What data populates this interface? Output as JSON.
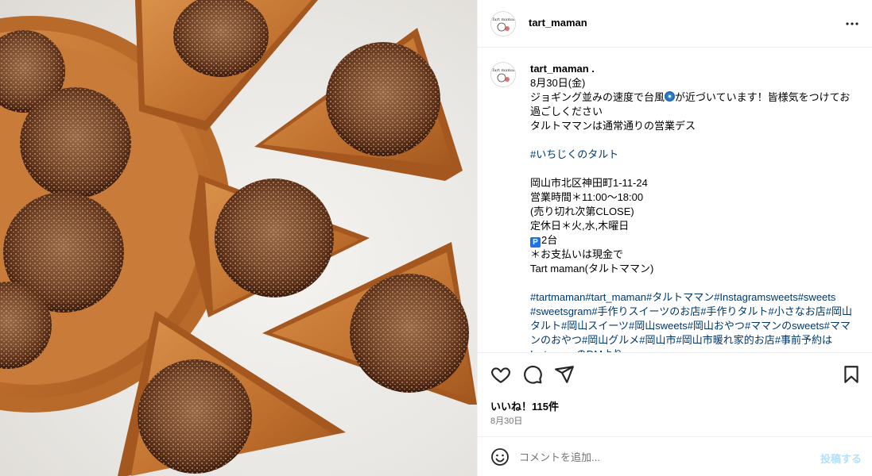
{
  "post": {
    "username": "tart_maman",
    "avatar_text": "Tart maman",
    "image_alt": "fig tart slices photo"
  },
  "caption": {
    "username": "tart_maman .",
    "lines": {
      "date": "8月30日(金)",
      "l1": "ジョギング並みの速度で台風",
      "l1b": "が近づいています！皆様気をつけてお過ごしください",
      "l2": "タルトママンは通常通りの営業デス",
      "tag1": "#いちじくのタルト",
      "addr": "岡山市北区神田町1-11-24",
      "hours": "営業時間＊11:00〜18:00",
      "soldout": "(売り切れ次第CLOSE)",
      "closed": "定休日＊火,水,木曜日",
      "parking_icon": "P",
      "parking": "2台",
      "payment": "＊お支払いは現金で",
      "shop": "Tart maman(タルトママン)"
    },
    "hashtags": [
      "#tartmaman",
      "#tart_maman",
      "#タルトママン",
      "#Instagramsweets",
      "#sweets",
      " #sweetsgram",
      "#手作りスイーツのお店",
      "#手作りタルト",
      "#小さなお店",
      "#岡山タルト",
      "#岡山スイーツ",
      "#岡山sweets",
      "#岡山おやつ",
      "#ママンのsweets",
      "#ママンのおやつ",
      "#岡山グルメ",
      "#岡山市",
      "#岡山市暖れ家的お店",
      "#事前予約はInstagramのDMより"
    ]
  },
  "stats": {
    "likes": "いいね！115件",
    "date": "8月30日"
  },
  "comment": {
    "placeholder": "コメントを追加...",
    "post_label": "投稿する"
  },
  "icons": {
    "more": "more-dots-icon",
    "like": "heart-icon",
    "comment": "comment-icon",
    "share": "send-icon",
    "save": "bookmark-icon",
    "emoji": "emoji-icon",
    "typhoon": "cyclone-emoji"
  },
  "colors": {
    "link": "#00376b",
    "border": "#efefef",
    "muted": "#737373",
    "post_disabled": "#b2dffc"
  }
}
